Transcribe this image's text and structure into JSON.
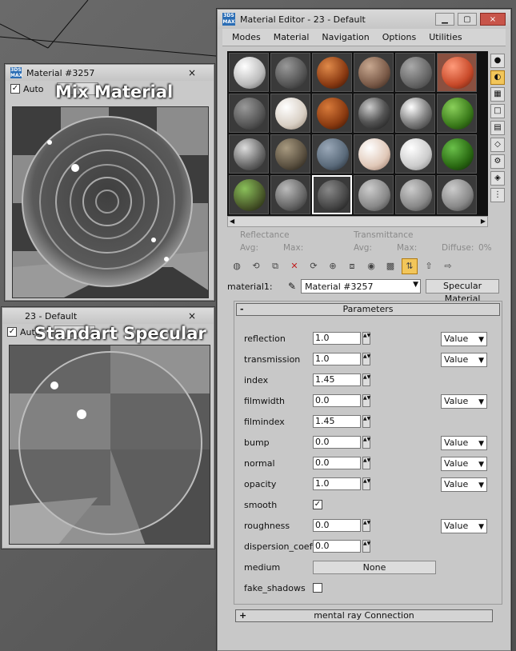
{
  "windows": {
    "preview1": {
      "title": "Material #3257",
      "auto_label": "Auto",
      "overlay": "Mix Material"
    },
    "preview2": {
      "title": "23 - Default",
      "auto_label": "Auto",
      "overlay": "Standart Specular"
    },
    "close_glyph": "×"
  },
  "editor": {
    "title": "Material Editor - 23 - Default",
    "logo_text": "3DS MAX",
    "menu": [
      "Modes",
      "Material",
      "Navigation",
      "Options",
      "Utilities"
    ],
    "reflectance": {
      "label": "Reflectance",
      "avg": "Avg:",
      "max": "Max:"
    },
    "transmittance": {
      "label": "Transmittance",
      "avg": "Avg:",
      "max": "Max:",
      "diffuse": "Diffuse:",
      "diffuse_value": "0%"
    },
    "material_row": {
      "label": "material1:",
      "name": "Material #3257",
      "type": "Specular Material"
    },
    "parameters_header": "Parameters",
    "params": [
      {
        "label": "reflection",
        "value": "1.0",
        "has_map": true
      },
      {
        "label": "transmission",
        "value": "1.0",
        "has_map": true
      },
      {
        "label": "index",
        "value": "1.45",
        "has_map": false
      },
      {
        "label": "filmwidth",
        "value": "0.0",
        "has_map": true
      },
      {
        "label": "filmindex",
        "value": "1.45",
        "has_map": false
      },
      {
        "label": "bump",
        "value": "0.0",
        "has_map": true
      },
      {
        "label": "normal",
        "value": "0.0",
        "has_map": true
      },
      {
        "label": "opacity",
        "value": "1.0",
        "has_map": true
      },
      {
        "label": "smooth",
        "checkbox": true,
        "checked": true
      },
      {
        "label": "roughness",
        "value": "0.0",
        "has_map": true
      },
      {
        "label": "dispersion_coeffic",
        "value": "0.0",
        "has_map": false
      },
      {
        "label": "medium",
        "button": "None"
      },
      {
        "label": "fake_shadows",
        "checkbox": true,
        "checked": false
      }
    ],
    "map_label": "Value",
    "mr_connection": "mental ray Connection",
    "collapse_sign": "-",
    "expand_sign": "+"
  }
}
